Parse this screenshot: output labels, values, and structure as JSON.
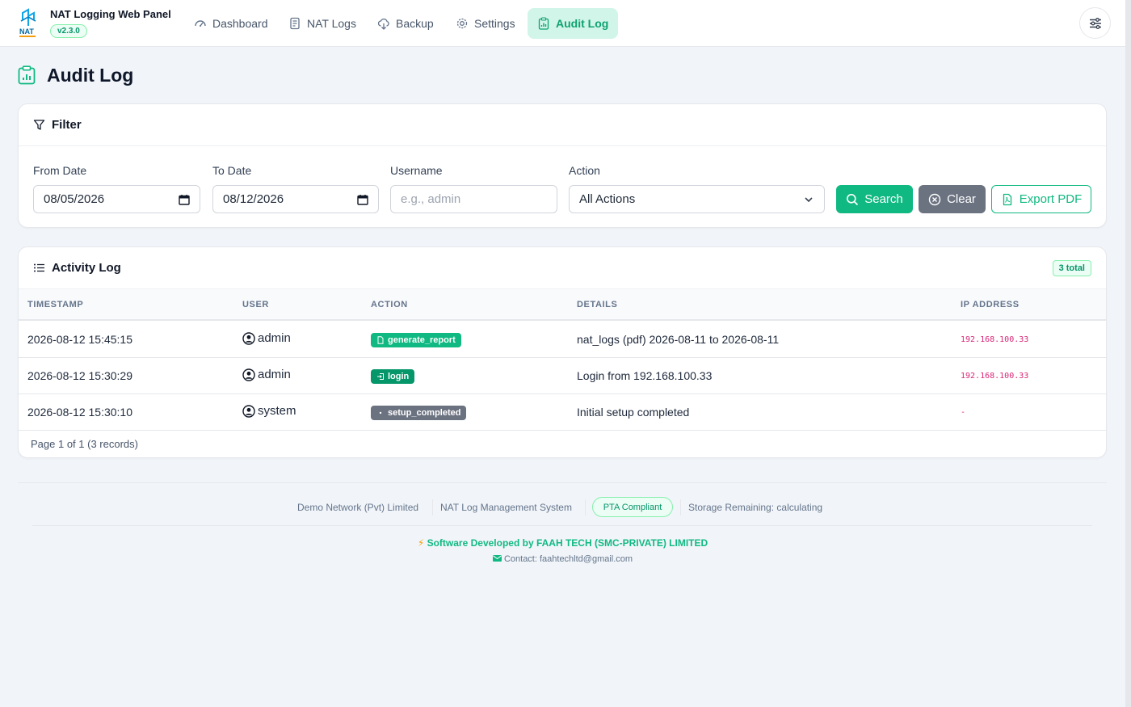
{
  "app": {
    "name": "NAT Logging Web Panel",
    "version": "v2.3.0",
    "logo_text": "NAT"
  },
  "nav": {
    "items": [
      {
        "label": "Dashboard",
        "icon": "gauge-icon",
        "active": false
      },
      {
        "label": "NAT Logs",
        "icon": "document-icon",
        "active": false
      },
      {
        "label": "Backup",
        "icon": "cloud-download-icon",
        "active": false
      },
      {
        "label": "Settings",
        "icon": "gear-icon",
        "active": false
      },
      {
        "label": "Audit Log",
        "icon": "clipboard-chart-icon",
        "active": true
      }
    ],
    "settings_button_icon": "sliders-icon"
  },
  "page": {
    "title": "Audit Log"
  },
  "filter": {
    "title": "Filter",
    "from_date": {
      "label": "From Date",
      "value": "08/05/2026"
    },
    "to_date": {
      "label": "To Date",
      "value": "08/12/2026"
    },
    "username": {
      "label": "Username",
      "placeholder": "e.g., admin",
      "value": ""
    },
    "action": {
      "label": "Action",
      "value": "All Actions"
    },
    "buttons": {
      "search": "Search",
      "clear": "Clear",
      "export": "Export PDF"
    }
  },
  "activity": {
    "title": "Activity Log",
    "total_badge": "3 total",
    "columns": [
      "TIMESTAMP",
      "USER",
      "ACTION",
      "DETAILS",
      "IP ADDRESS"
    ],
    "rows": [
      {
        "timestamp": "2026-08-12 15:45:15",
        "user": "admin",
        "action": "generate_report",
        "action_color": "#10b981",
        "action_icon": "file-pdf-icon",
        "details": "nat_logs (pdf) 2026-08-11 to 2026-08-11",
        "ip": "192.168.100.33"
      },
      {
        "timestamp": "2026-08-12 15:30:29",
        "user": "admin",
        "action": "login",
        "action_color": "#059669",
        "action_icon": "login-icon",
        "details": "Login from 192.168.100.33",
        "ip": "192.168.100.33"
      },
      {
        "timestamp": "2026-08-12 15:30:10",
        "user": "system",
        "action": "setup_completed",
        "action_color": "#6b7280",
        "action_icon": "dot-icon",
        "details": "Initial setup completed",
        "ip": "-"
      }
    ],
    "pagination": "Page 1 of 1 (3 records)"
  },
  "footer": {
    "company": "Demo Network (Pvt) Limited",
    "system": "NAT Log Management System",
    "compliance": "PTA Compliant",
    "storage": "Storage Remaining: calculating",
    "developer": "Software Developed by FAAH TECH (SMC-PRIVATE) LIMITED",
    "contact": "Contact: faahtechltd@gmail.com"
  },
  "colors": {
    "accent": "#10b981",
    "accent_dark": "#059669",
    "ip_text": "#db2777",
    "clear_button": "#6b7280"
  }
}
